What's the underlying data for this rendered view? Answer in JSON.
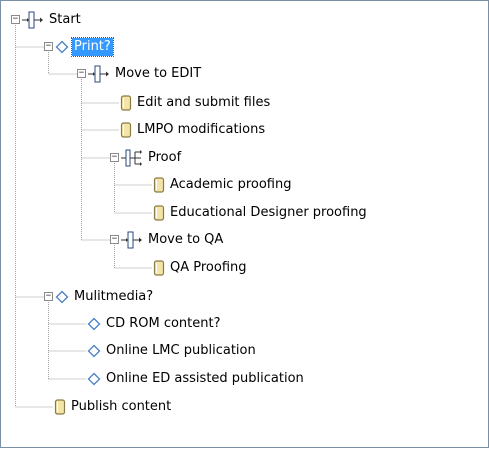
{
  "tree": {
    "nodes": [
      {
        "id": "start",
        "label": "Start",
        "icon": "gateway-icon",
        "expander": "minus"
      },
      {
        "id": "print",
        "label": "Print?",
        "icon": "diamond-icon",
        "expander": "minus",
        "selected": true
      },
      {
        "id": "move_edit",
        "label": "Move to EDIT",
        "icon": "gateway-icon",
        "expander": "minus"
      },
      {
        "id": "edit_submit",
        "label": "Edit and submit files",
        "icon": "task-icon"
      },
      {
        "id": "lmpo",
        "label": "LMPO modifications",
        "icon": "task-icon"
      },
      {
        "id": "proof",
        "label": "Proof",
        "icon": "parallel-gateway-icon",
        "expander": "minus"
      },
      {
        "id": "academic",
        "label": "Academic proofing",
        "icon": "task-icon"
      },
      {
        "id": "educational",
        "label": "Educational Designer proofing",
        "icon": "task-icon"
      },
      {
        "id": "move_qa",
        "label": "Move to QA",
        "icon": "gateway-icon",
        "expander": "minus"
      },
      {
        "id": "qa_proofing",
        "label": "QA Proofing",
        "icon": "task-icon"
      },
      {
        "id": "multimedia",
        "label": "Mulitmedia?",
        "icon": "diamond-icon",
        "expander": "minus"
      },
      {
        "id": "cdrom",
        "label": "CD ROM content?",
        "icon": "diamond-icon"
      },
      {
        "id": "online_lmc",
        "label": "Online LMC publication",
        "icon": "diamond-icon"
      },
      {
        "id": "online_ed",
        "label": "Online ED assisted publication",
        "icon": "diamond-icon"
      },
      {
        "id": "publish",
        "label": "Publish content",
        "icon": "task-icon"
      }
    ]
  },
  "colors": {
    "selection": "#3399ff",
    "diamond": "#4a7fc4",
    "task": "#8a7a45",
    "gateway": "#2a4a7a",
    "tree_line": "#a0a0a0"
  }
}
